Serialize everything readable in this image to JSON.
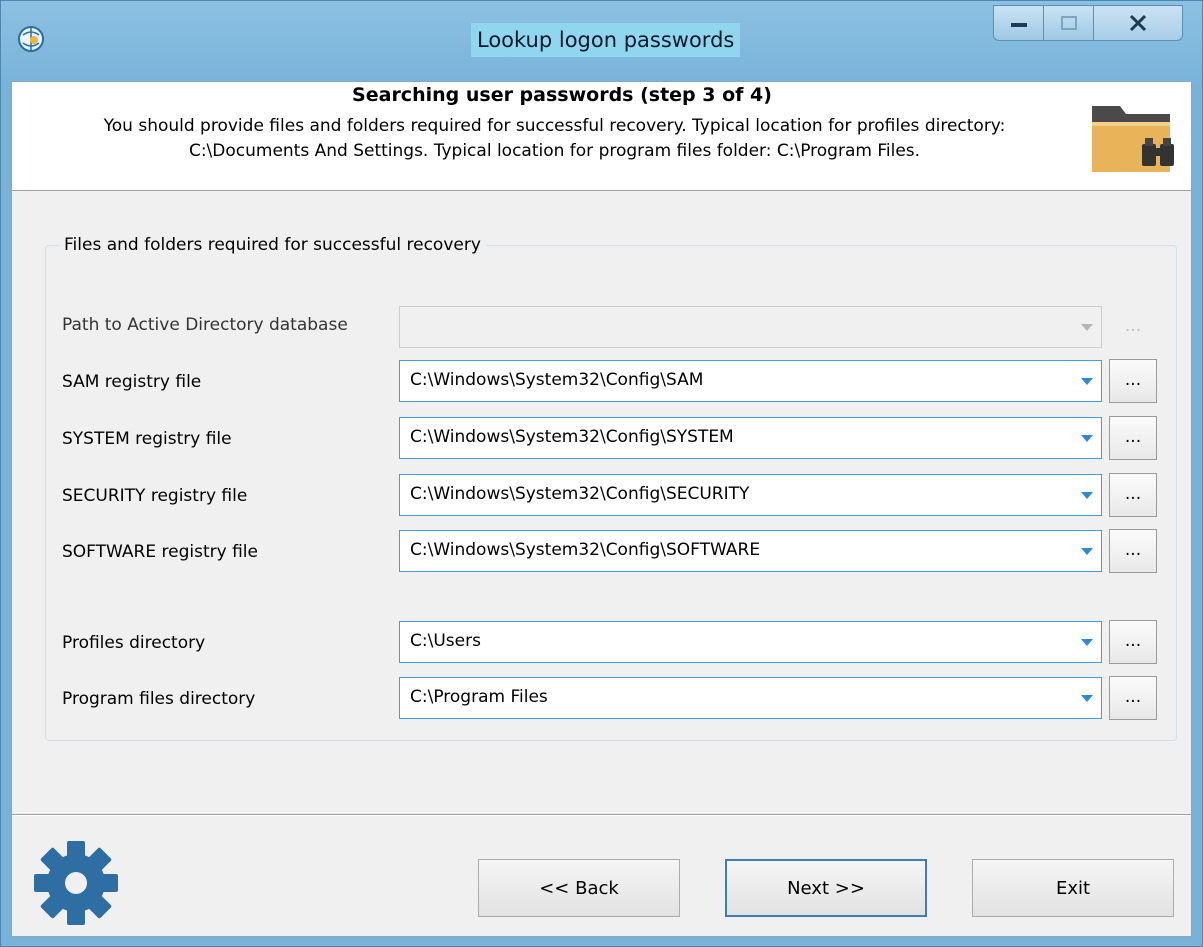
{
  "window": {
    "title": "Lookup logon passwords",
    "controls": [
      "minimize",
      "maximize",
      "close"
    ]
  },
  "header": {
    "title": "Searching user passwords (step 3 of 4)",
    "description_line1": "You should provide files and folders required for successful recovery. Typical location for profiles directory:",
    "description_line2": "C:\\Documents And Settings. Typical location for program files folder: C:\\Program Files.",
    "icon": "folder-binoculars-icon"
  },
  "group": {
    "title": "Files and folders required for successful recovery",
    "fields": [
      {
        "label": "Path to Active Directory database",
        "value": "",
        "browse": "...",
        "enabled": false
      },
      {
        "label": "SAM registry file",
        "value": "C:\\Windows\\System32\\Config\\SAM",
        "browse": "...",
        "enabled": true
      },
      {
        "label": "SYSTEM registry file",
        "value": "C:\\Windows\\System32\\Config\\SYSTEM",
        "browse": "...",
        "enabled": true
      },
      {
        "label": "SECURITY registry file",
        "value": "C:\\Windows\\System32\\Config\\SECURITY",
        "browse": "...",
        "enabled": true
      },
      {
        "label": "SOFTWARE registry file",
        "value": "C:\\Windows\\System32\\Config\\SOFTWARE",
        "browse": "...",
        "enabled": true
      },
      {
        "label": "Profiles directory",
        "value": "C:\\Users",
        "browse": "...",
        "enabled": true
      },
      {
        "label": "Program files directory",
        "value": "C:\\Program Files",
        "browse": "...",
        "enabled": true
      }
    ]
  },
  "buttons": {
    "back": "<< Back",
    "next": "Next >>",
    "exit": "Exit"
  },
  "colors": {
    "window_frame": "#78b2d8",
    "accent": "#3c9ee8",
    "gear": "#2f6ea3",
    "folder": "#e9b35a"
  }
}
